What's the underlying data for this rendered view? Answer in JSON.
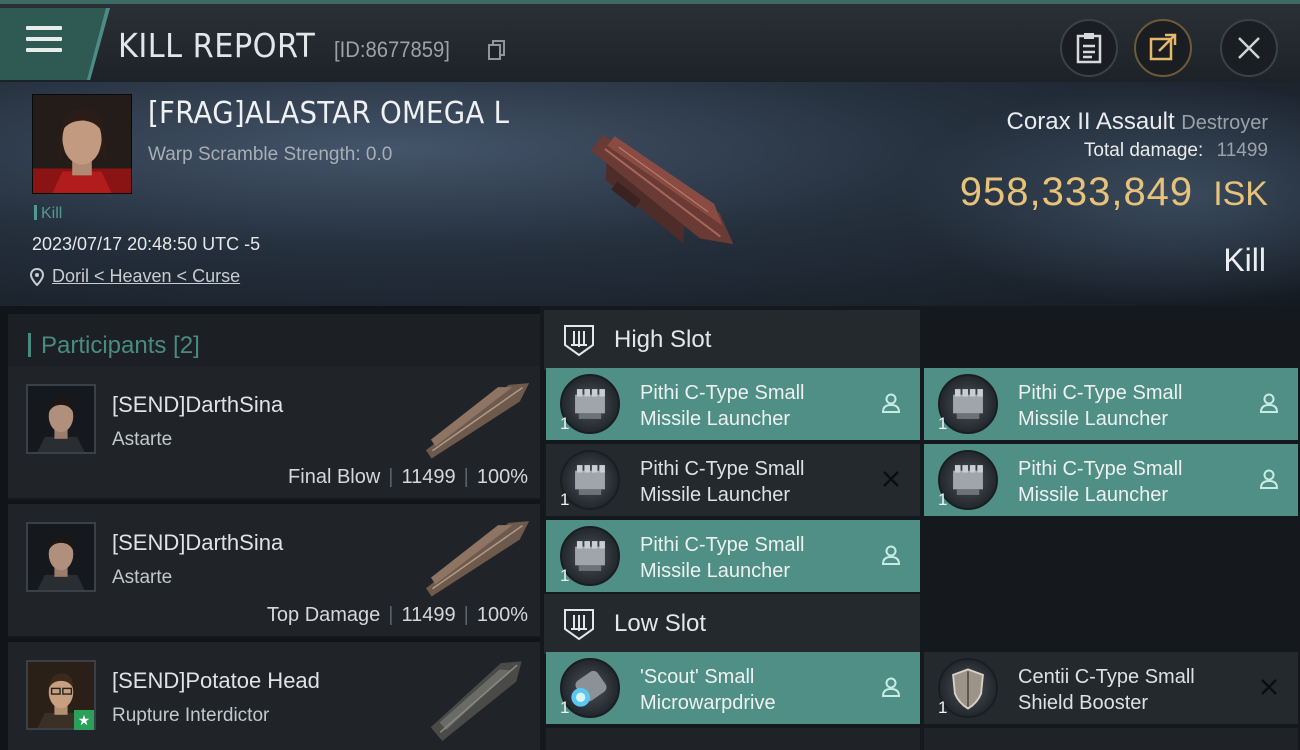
{
  "header": {
    "title": "KILL REPORT",
    "id_label": "[ID:8677859]",
    "buttons": [
      "clipboard-icon",
      "share-icon",
      "close-icon"
    ]
  },
  "victim": {
    "name": "[FRAG]ALASTAR OMEGA L",
    "scramble": "Warp Scramble Strength: 0.0",
    "tag": "Kill",
    "datetime": "2023/07/17 20:48:50 UTC -5",
    "location": "Doril < Heaven < Curse",
    "ship_name": "Corax II Assault",
    "ship_class": "Destroyer",
    "damage_label": "Total damage:",
    "damage_value": "11499",
    "isk_value": "958,333,849",
    "isk_unit": "ISK",
    "result": "Kill"
  },
  "participants": {
    "title": "Participants [2]",
    "rows": [
      {
        "name": "[SEND]DarthSina",
        "ship": "Astarte",
        "role": "Final Blow",
        "damage": "11499",
        "percent": "100%"
      },
      {
        "name": "[SEND]DarthSina",
        "ship": "Astarte",
        "role": "Top Damage",
        "damage": "11499",
        "percent": "100%"
      },
      {
        "name": "[SEND]Potatoe Head",
        "ship": "Rupture Interdictor",
        "role": "",
        "damage": "",
        "percent": ""
      }
    ]
  },
  "high_slot": {
    "title": "High Slot",
    "modules": [
      {
        "line1": "Pithi C-Type Small",
        "line2": "Missile Launcher",
        "qty": "1",
        "status": "person-icon"
      },
      {
        "line1": "Pithi C-Type Small",
        "line2": "Missile Launcher",
        "qty": "1",
        "status": "person-icon"
      },
      {
        "line1": "Pithi C-Type Small",
        "line2": "Missile Launcher",
        "qty": "1",
        "status": "x-icon"
      },
      {
        "line1": "Pithi C-Type Small",
        "line2": "Missile Launcher",
        "qty": "1",
        "status": "person-icon"
      },
      {
        "line1": "Pithi C-Type Small",
        "line2": "Missile Launcher",
        "qty": "1",
        "status": "person-icon"
      }
    ]
  },
  "low_slot": {
    "title": "Low Slot",
    "modules": [
      {
        "line1": "'Scout' Small",
        "line2": "Microwarpdrive",
        "qty": "1",
        "status": "person-icon"
      },
      {
        "line1": "Centii C-Type Small",
        "line2": "Shield Booster",
        "qty": "1",
        "status": "x-icon"
      }
    ]
  },
  "colors": {
    "accent_teal": "#4f8f85",
    "isk_gold": "#e7c27a",
    "panel_dark": "#24292e"
  }
}
